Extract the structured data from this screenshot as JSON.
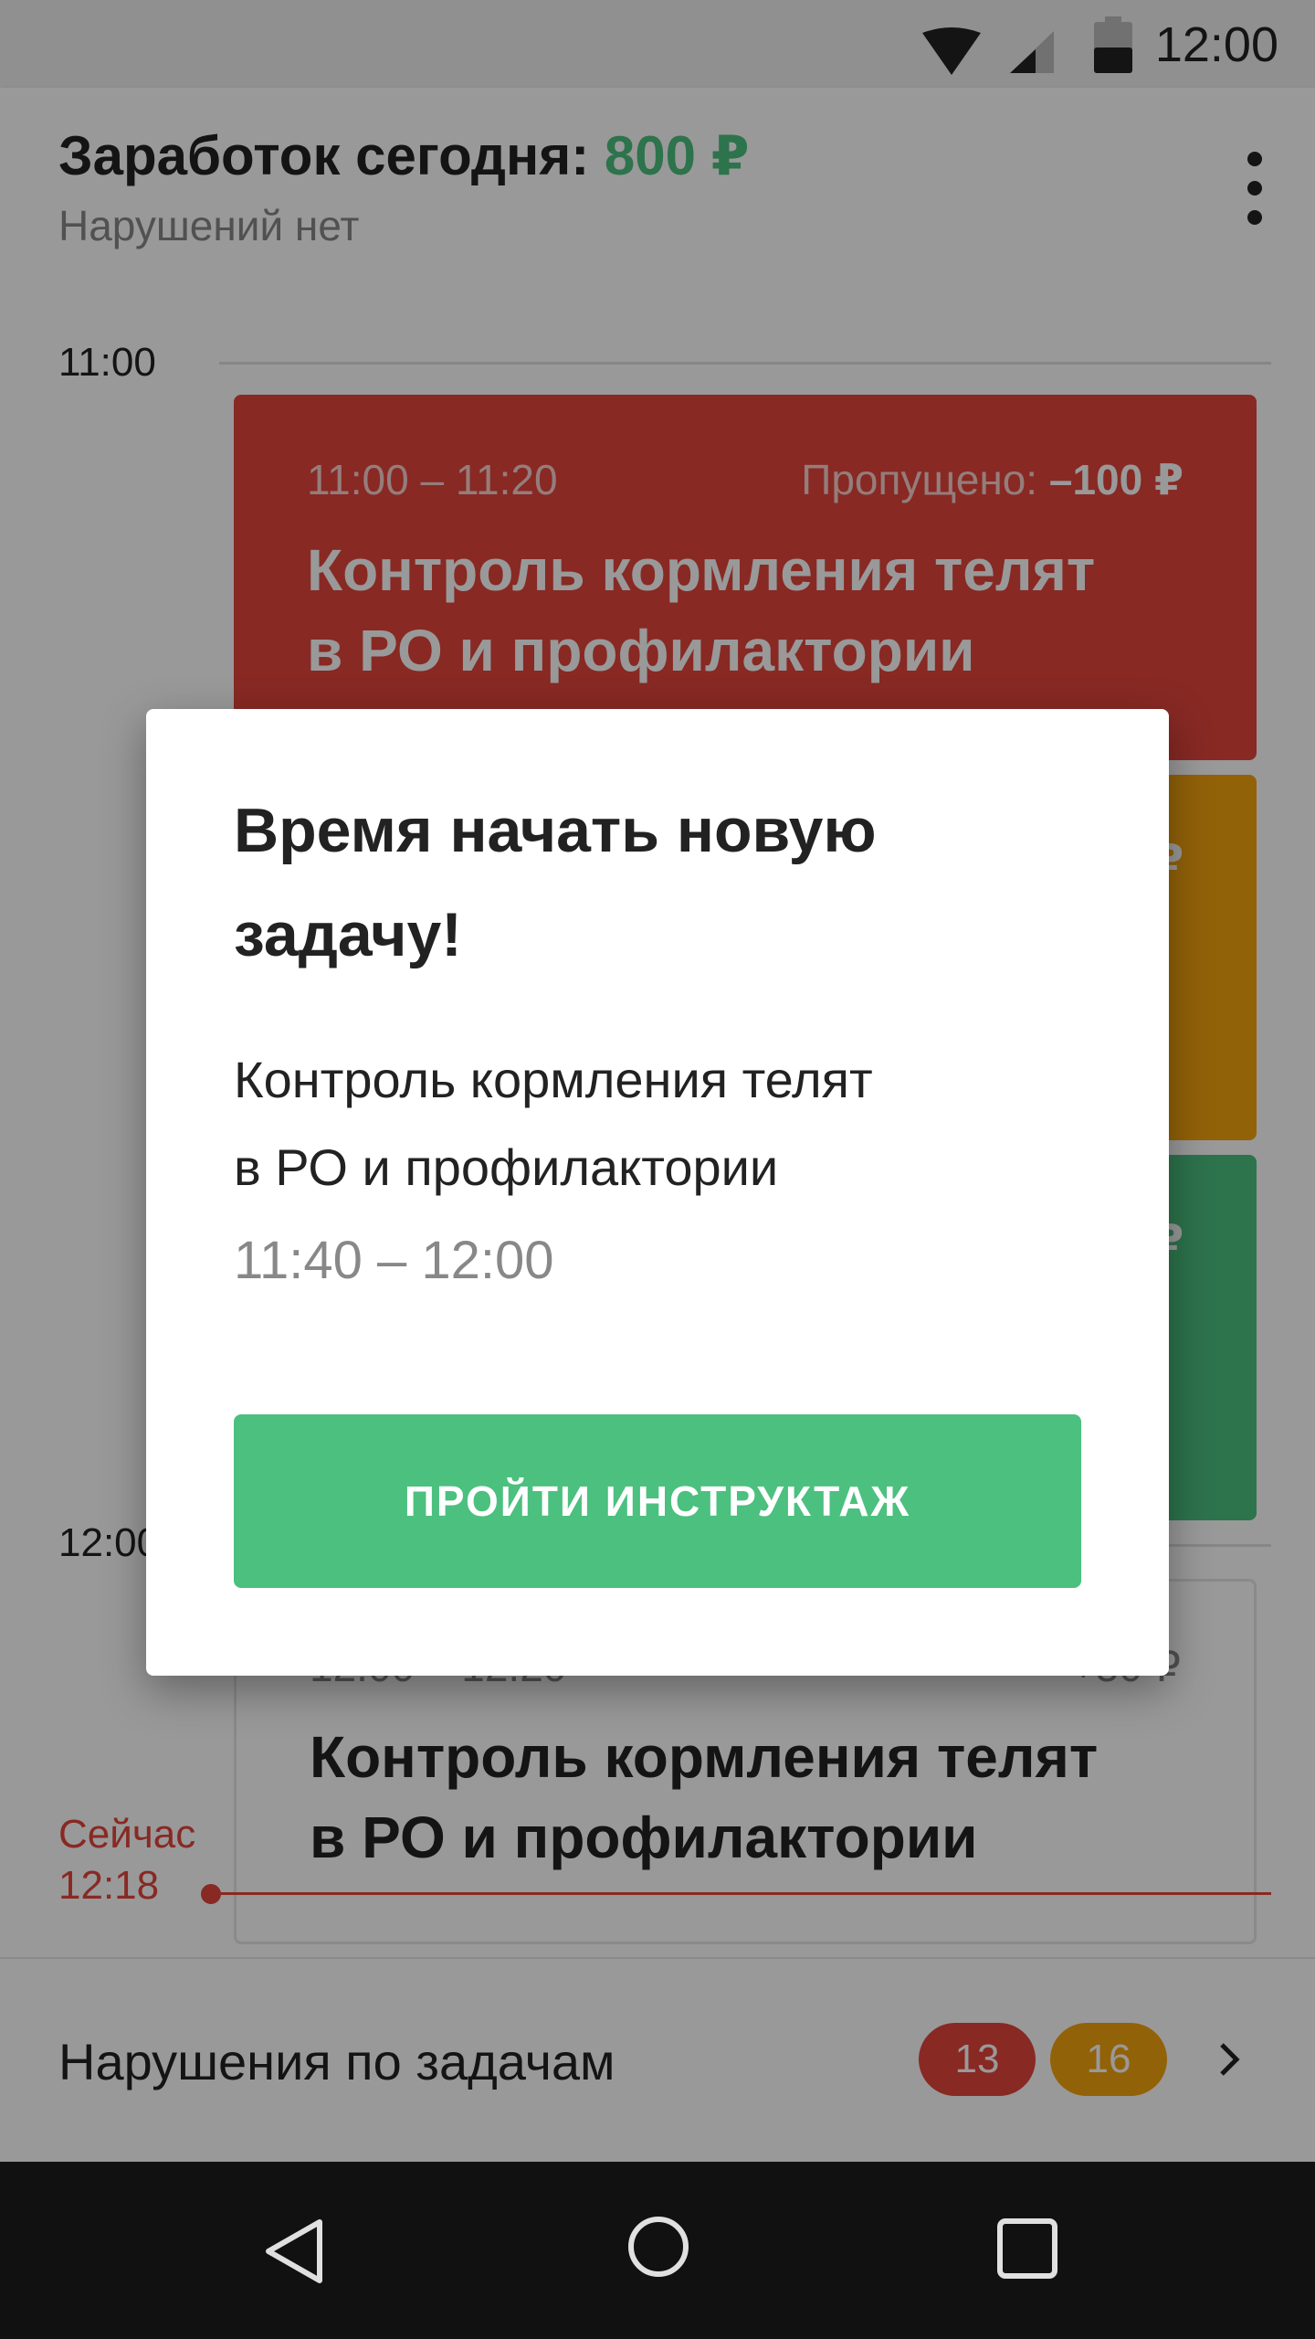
{
  "status_bar": {
    "time": "12:00"
  },
  "header": {
    "title_prefix": "Заработок сегодня:",
    "earnings": "800 ₽",
    "subtitle": "Нарушений нет"
  },
  "timeline": {
    "hour_labels": [
      "11:00",
      "12:00"
    ],
    "cards": [
      {
        "time": "11:00 – 11:20",
        "meta_label": "Пропущено:",
        "meta_value": "–100 ₽",
        "title_line1": "Контроль кормления телят",
        "title_line2": "в РО и профилактории",
        "color": "#e3453c"
      },
      {
        "time": "",
        "meta_label": "",
        "meta_value": "₽",
        "title_line1": "",
        "title_line2": "",
        "color": "#f4a40f"
      },
      {
        "time": "",
        "meta_label": "",
        "meta_value": "₽",
        "title_line1": "",
        "title_line2": "",
        "color": "#4cc07f"
      },
      {
        "time": "12:00 – 12:20",
        "meta_label": "",
        "meta_value": "+50 ₽",
        "title_line1": "Контроль кормления телят",
        "title_line2": "в РО и профилактории",
        "color": "#ffffff"
      }
    ],
    "now_label": "Сейчас",
    "now_time": "12:18"
  },
  "violations": {
    "label": "Нарушения по задачам",
    "count_red": "13",
    "count_orange": "16"
  },
  "dialog": {
    "title": "Время начать новую задачу!",
    "task_line1": "Контроль кормления телят",
    "task_line2": "в РО и профилактории",
    "time": "11:40 – 12:00",
    "button_label": "ПРОЙТИ ИНСТРУКТАЖ"
  },
  "colors": {
    "accent_green": "#4cc07f",
    "red": "#e3453c",
    "orange": "#f4a40f"
  }
}
